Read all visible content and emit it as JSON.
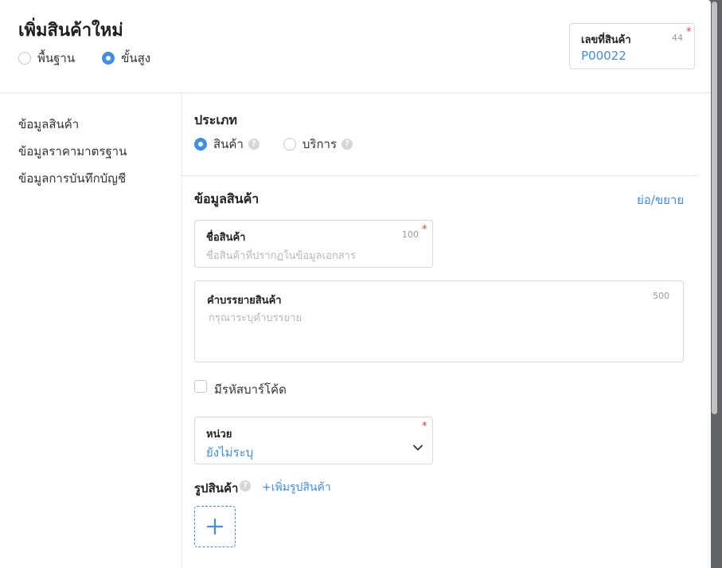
{
  "header": {
    "title": "เพิ่มสินค้าใหม่",
    "mode_options": [
      {
        "label": "พื้นฐาน",
        "selected": false
      },
      {
        "label": "ขั้นสูง",
        "selected": true
      }
    ],
    "product_code": {
      "label": "เลขที่สินค้า",
      "value": "P00022",
      "counter": "44",
      "required": "*"
    }
  },
  "sidebar": {
    "items": [
      {
        "label": "ข้อมูลสินค้า"
      },
      {
        "label": "ข้อมูลราคามาตรฐาน"
      },
      {
        "label": "ข้อมูลการบันทึกบัญชี"
      }
    ]
  },
  "type_section": {
    "title": "ประเภท",
    "options": [
      {
        "label": "สินค้า",
        "selected": true
      },
      {
        "label": "บริการ",
        "selected": false
      }
    ]
  },
  "product_info": {
    "title": "ข้อมูลสินค้า",
    "toggle_label": "ย่อ/ขยาย",
    "name_field": {
      "label": "ชื่อสินค้า",
      "counter": "100",
      "required": "*",
      "placeholder": "ชื่อสินค้าที่ปรากฏในข้อมูลเอกสาร"
    },
    "description_field": {
      "label": "คำบรรยายสินค้า",
      "counter": "500",
      "placeholder": "กรุณาระบุคำบรรยาย"
    },
    "barcode_checkbox": {
      "label": "มีรหัสบาร์โค้ด",
      "checked": false
    },
    "unit_field": {
      "label": "หน่วย",
      "required": "*",
      "value": "ยังไม่ระบุ"
    },
    "image": {
      "label": "รูปสินค้า",
      "add_link": "+เพิ่มรูปสินค้า"
    }
  },
  "colors": {
    "accent": "#3d8ee8",
    "required": "#e53935"
  }
}
